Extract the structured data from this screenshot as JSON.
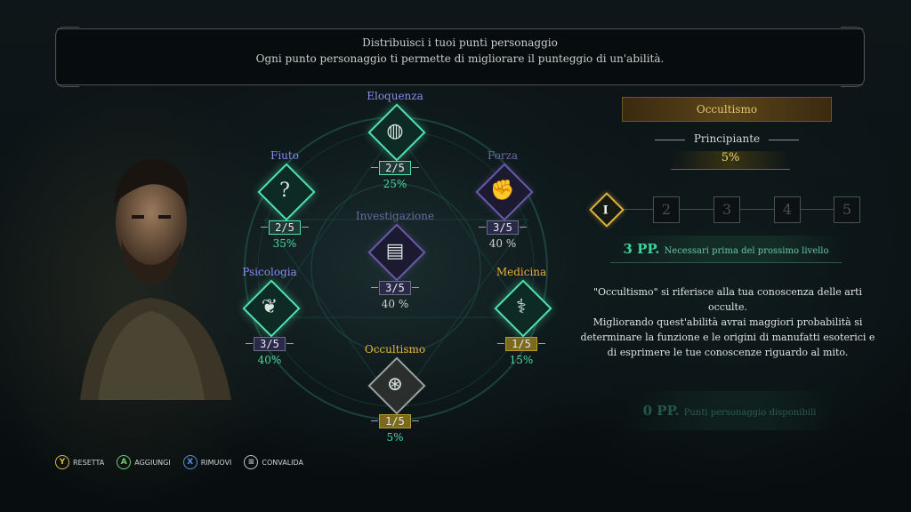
{
  "banner": {
    "line1": "Distribuisci i tuoi punti personaggio",
    "line2": "Ogni punto personaggio ti permette di migliorare il punteggio di un'abilità."
  },
  "skills": [
    {
      "key": "eloquenza",
      "name": "Eloquenza",
      "level": "2/5",
      "pct": "25%",
      "name_color": "#8a8cf0",
      "pct_color": "#4fd9a0",
      "icon": "coins-icon"
    },
    {
      "key": "fiuto",
      "name": "Fiuto",
      "level": "2/5",
      "pct": "35%",
      "name_color": "#8a8cf0",
      "pct_color": "#4fd9a0",
      "icon": "question-icon"
    },
    {
      "key": "forza",
      "name": "Forza",
      "level": "3/5",
      "pct": "40 %",
      "name_color": "#6b6aa8",
      "pct_color": "#d0d4d2",
      "icon": "fist-icon"
    },
    {
      "key": "investigazione",
      "name": "Investigazione",
      "level": "3/5",
      "pct": "40 %",
      "name_color": "#6b6aa8",
      "pct_color": "#d0d4d2",
      "icon": "documents-icon"
    },
    {
      "key": "psicologia",
      "name": "Psicologia",
      "level": "3/5",
      "pct": "40%",
      "name_color": "#8a8cf0",
      "pct_color": "#4fd9a0",
      "icon": "brain-icon"
    },
    {
      "key": "medicina",
      "name": "Medicina",
      "level": "1/5",
      "pct": "15%",
      "name_color": "#e8b23c",
      "pct_color": "#4fd9a0",
      "icon": "caduceus-icon"
    },
    {
      "key": "occultismo",
      "name": "Occultismo",
      "level": "1/5",
      "pct": "5%",
      "name_color": "#e8b23c",
      "pct_color": "#4fd9a0",
      "icon": "occult-sigil-icon"
    }
  ],
  "detail": {
    "title": "Occultismo",
    "rank": "Principiante",
    "progress": "5%",
    "levels": [
      "I",
      "2",
      "3",
      "4",
      "5"
    ],
    "pp_needed_value": "3 PP.",
    "pp_needed_label": "Necessari prima del prossimo livello",
    "description": "\"Occultismo\" si riferisce alla tua conoscenza delle arti occulte.\nMigliorando quest'abilità avrai maggiori probabilità si determinare la funzione e le origini di manufatti esoterici e di esprimere le tue conoscenze riguardo al mito.",
    "pp_available_value": "0 PP.",
    "pp_available_label": "Punti personaggio disponibili"
  },
  "footer": [
    {
      "button": "Y",
      "label": "RESETTA",
      "color": "#d9b84a"
    },
    {
      "button": "A",
      "label": "AGGIUNGI",
      "color": "#6fcf6f"
    },
    {
      "button": "X",
      "label": "RIMUOVI",
      "color": "#5b8de0"
    },
    {
      "button": "≡",
      "label": "CONVALIDA",
      "color": "#c0c6c3"
    }
  ],
  "colors": {
    "accent_green": "#4fe3b0",
    "accent_gold": "#e0b13c",
    "accent_purple": "#6a5aa8"
  }
}
